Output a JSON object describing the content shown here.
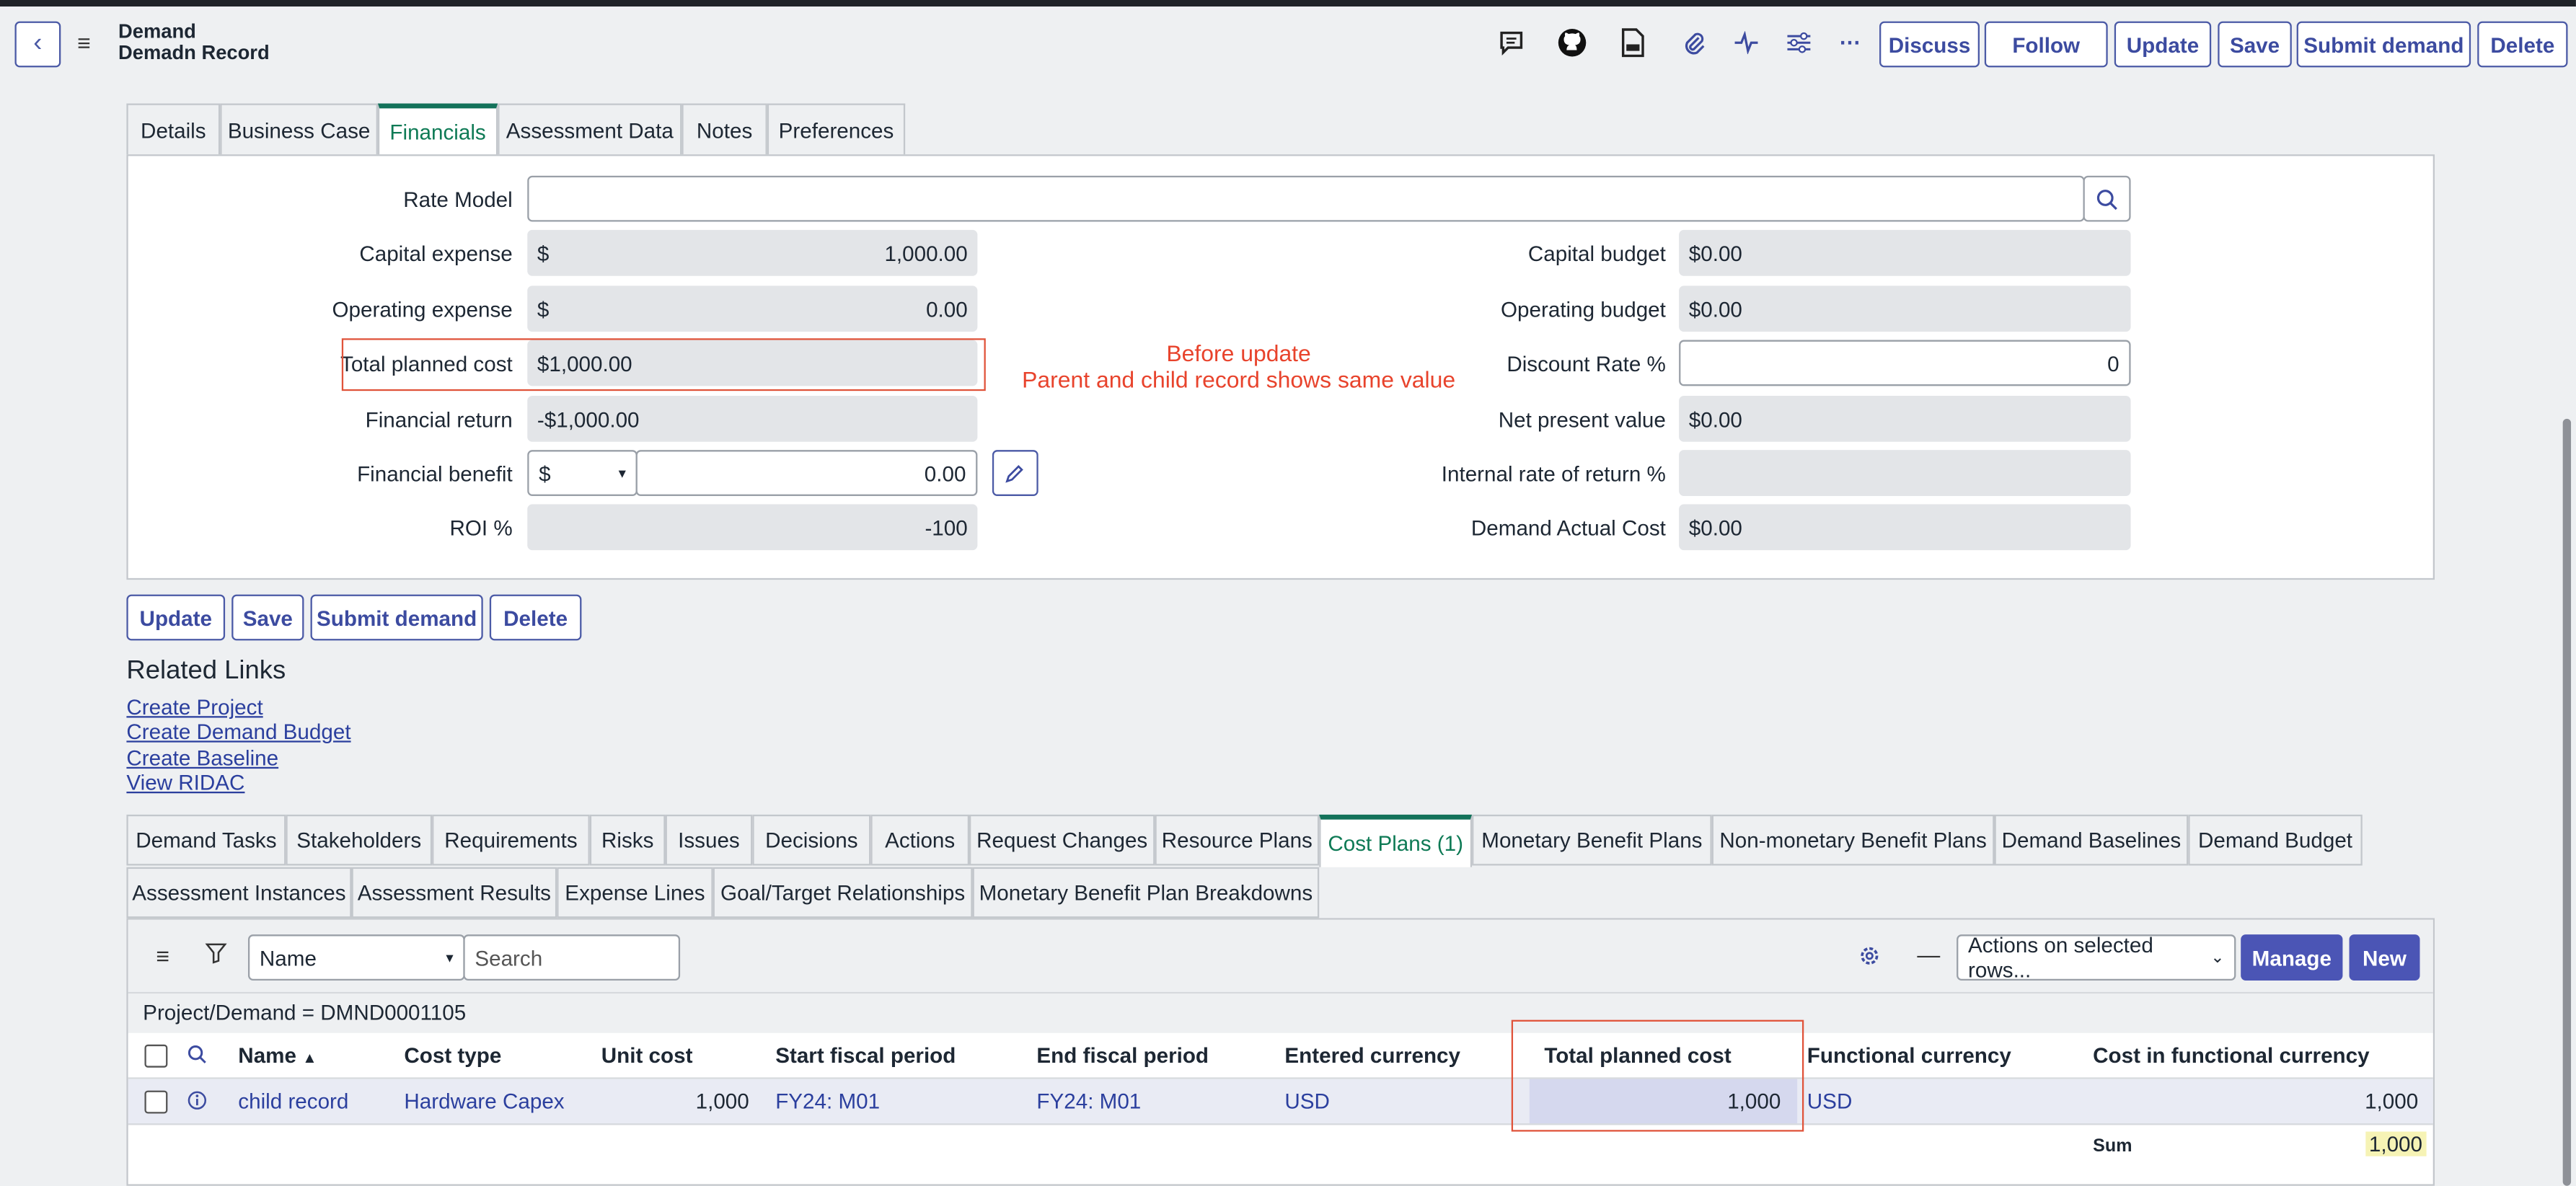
{
  "header": {
    "back_icon": "chevron-left-icon",
    "title_line1": "Demand",
    "title_line2": "Demadn Record",
    "icons": [
      "comment-icon",
      "github-icon",
      "document-icon",
      "paperclip-icon",
      "activity-icon",
      "sliders-icon",
      "more-icon"
    ],
    "buttons": [
      "Discuss",
      "Follow",
      "Update",
      "Save",
      "Submit demand",
      "Delete"
    ]
  },
  "form_tabs": [
    "Details",
    "Business Case",
    "Financials",
    "Assessment Data",
    "Notes",
    "Preferences"
  ],
  "financials": {
    "rate_model_label": "Rate Model",
    "rate_model_value": "",
    "capital_expense_label": "Capital expense",
    "capital_expense_currency": "$",
    "capital_expense_value": "1,000.00",
    "operating_expense_label": "Operating expense",
    "operating_expense_currency": "$",
    "operating_expense_value": "0.00",
    "total_planned_cost_label": "Total planned cost",
    "total_planned_cost_value": "$1,000.00",
    "financial_return_label": "Financial return",
    "financial_return_value": "-$1,000.00",
    "financial_benefit_label": "Financial benefit",
    "financial_benefit_currency": "$",
    "financial_benefit_value": "0.00",
    "roi_label": "ROI %",
    "roi_value": "-100",
    "capital_budget_label": "Capital budget",
    "capital_budget_value": "$0.00",
    "operating_budget_label": "Operating budget",
    "operating_budget_value": "$0.00",
    "discount_rate_label": "Discount Rate %",
    "discount_rate_value": "0",
    "npv_label": "Net present value",
    "npv_value": "$0.00",
    "irr_label": "Internal rate of return %",
    "irr_value": "",
    "demand_actual_cost_label": "Demand Actual Cost",
    "demand_actual_cost_value": "$0.00"
  },
  "annotation": {
    "line1": "Before update",
    "line2": "Parent and child record shows same value",
    "color": "#e8432c"
  },
  "form_buttons": [
    "Update",
    "Save",
    "Submit demand",
    "Delete"
  ],
  "related_links": {
    "title": "Related Links",
    "links": [
      "Create Project",
      "Create Demand Budget",
      "Create Baseline",
      "View RIDAC"
    ]
  },
  "related_tabs_row1": [
    "Demand Tasks",
    "Stakeholders",
    "Requirements",
    "Risks",
    "Issues",
    "Decisions",
    "Actions",
    "Request Changes",
    "Resource Plans",
    "Cost Plans (1)",
    "Monetary Benefit Plans",
    "Non-monetary Benefit Plans",
    "Demand Baselines",
    "Demand Budget"
  ],
  "related_tabs_row2": [
    "Assessment Instances",
    "Assessment Results",
    "Expense Lines",
    "Goal/Target Relationships",
    "Monetary Benefit Plan Breakdowns"
  ],
  "list": {
    "search_field": "Name",
    "search_placeholder": "Search",
    "actions_select": "Actions on selected rows...",
    "manage_label": "Manage",
    "new_label": "New",
    "filter_text": "Project/Demand = DMND0001105",
    "columns": [
      "Name",
      "Cost type",
      "Unit cost",
      "Start fiscal period",
      "End fiscal period",
      "Entered currency",
      "Total planned cost",
      "Functional currency",
      "Cost in functional currency"
    ],
    "rows": [
      {
        "name": "child record",
        "cost_type": "Hardware Capex",
        "unit_cost": "1,000",
        "start_period": "FY24: M01",
        "end_period": "FY24: M01",
        "entered_currency": "USD",
        "total_planned_cost": "1,000",
        "functional_currency": "USD",
        "cost_functional": "1,000"
      }
    ],
    "sum_label": "Sum",
    "sum_value": "1,000"
  },
  "colors": {
    "accent": "#3c4ba0",
    "active_tab": "#0e7a55",
    "highlight": "#e0533a",
    "manage_bg": "#4b55b5"
  }
}
